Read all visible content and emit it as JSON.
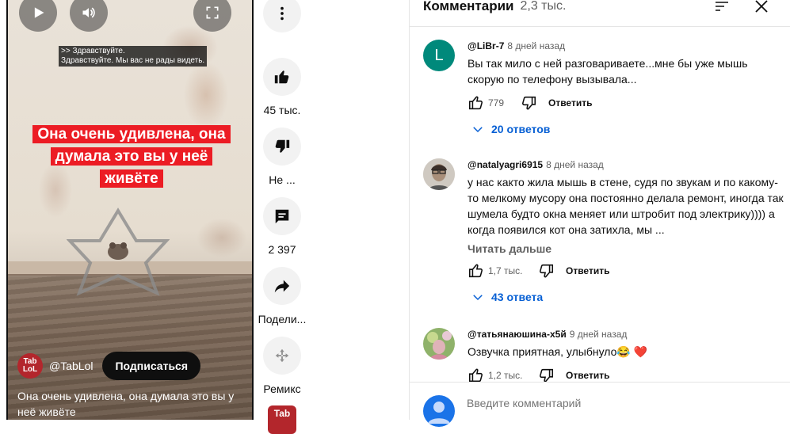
{
  "video": {
    "subtitles_line1": ">> Здравствуйте.",
    "subtitles_line2": "Здравствуйте. Мы вас не рады видеть.",
    "caption": "Она очень удивлена, она думала это вы у неё живёте",
    "channel_logo_top": "Tab",
    "channel_logo_bottom": "LoL",
    "channel": "@TabLol",
    "subscribe_label": "Подписаться",
    "description": "Она очень удивлена, она думала это вы у неё живёте"
  },
  "actions": {
    "like_count": "45 тыс.",
    "dislike_label": "Не ...",
    "comment_count": "2 397",
    "share_label": "Подели...",
    "remix_label": "Ремикс",
    "next_channel_logo": "Tab"
  },
  "comments": {
    "title": "Комментарии",
    "count": "2,3 тыс.",
    "reply_label": "Ответить",
    "input_placeholder": "Введите комментарий",
    "items": [
      {
        "avatar_letter": "L",
        "handle": "@LiBr-7",
        "time": "8 дней назад",
        "text": "Вы так мило с ней разговариваете...мне бы уже мышь скорую по телефону вызывала...",
        "likes": "779",
        "replies": "20 ответов"
      },
      {
        "handle": "@natalyagri6915",
        "time": "8 дней назад",
        "text": "у нас както жила мышь в стене, судя по звукам и по какому-то мелкому мусору она постоянно делала ремонт, иногда так шумела будто окна меняет или штробит под электрику)))) а когда появился кот она затихла, мы ...",
        "read_more": "Читать дальше",
        "likes": "1,7 тыс.",
        "replies": "43 ответа"
      },
      {
        "handle": "@татьянаюшина-х5й",
        "time": "9 дней назад",
        "text": "Озвучка приятная, улыбнуло😂 ❤️",
        "likes": "1,2 тыс."
      }
    ]
  },
  "colors": {
    "caption_red": "#ec1c24",
    "link_blue": "#065fd4",
    "avatar_teal": "#00897b"
  }
}
